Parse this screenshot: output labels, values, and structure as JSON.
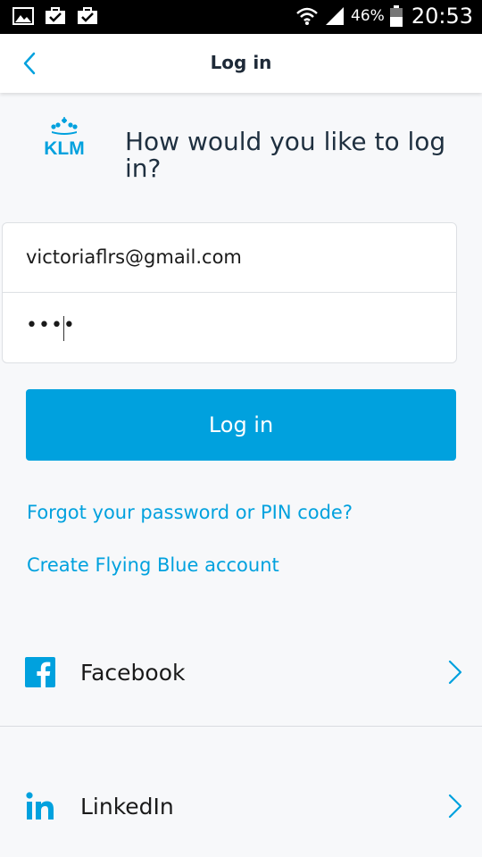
{
  "status_bar": {
    "battery": "46%",
    "clock": "20:53"
  },
  "app_bar": {
    "title": "Log in"
  },
  "header": {
    "brand": "KLM",
    "heading": "How would you like to log in?"
  },
  "form": {
    "email_value": "victoriaflrs@gmail.com",
    "password_masked": "••••"
  },
  "actions": {
    "login_label": "Log in",
    "forgot_link": "Forgot your password or PIN code?",
    "create_link": "Create Flying Blue account"
  },
  "social": [
    {
      "label": "Facebook",
      "icon": "facebook-icon"
    },
    {
      "label": "LinkedIn",
      "icon": "linkedin-icon"
    }
  ],
  "colors": {
    "accent": "#00a1de",
    "text": "#1f3040",
    "background": "#f7f8fa"
  }
}
